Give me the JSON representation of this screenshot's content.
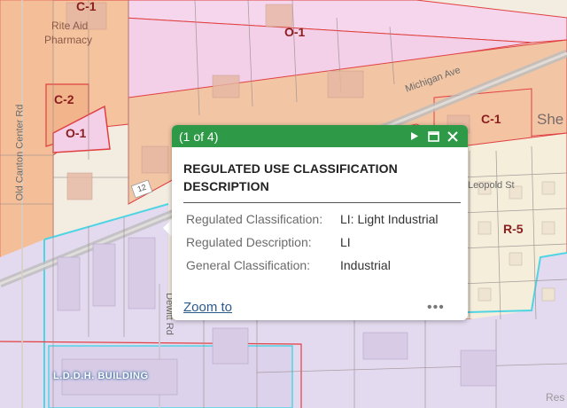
{
  "map": {
    "zones": [
      {
        "label": "C-1",
        "color": "#8a1d1d"
      },
      {
        "label": "O-1",
        "color": "#8a1d1d"
      },
      {
        "label": "C-2",
        "color": "#8a1d1d"
      },
      {
        "label": "O-1",
        "color": "#8a1d1d"
      },
      {
        "label": "C-1",
        "color": "#8a1d1d"
      },
      {
        "label": "R-5",
        "color": "#8a1d1d"
      }
    ],
    "roads": {
      "old_canton": "Old Canton Center Rd",
      "michigan": "Michigan Ave",
      "dewitt": "Dewitt Rd",
      "route": "12",
      "leopold": "Leopold St"
    },
    "places": {
      "pharmacy_line1": "Rite Aid",
      "pharmacy_line2": "Pharmacy",
      "partial_right": "She",
      "partial_corner": "Res"
    },
    "building_label": "L.D.D.H. BUILDING",
    "colors": {
      "commercial": "#f5c8a6",
      "office": "#f4d2ea",
      "residential": "#f4ecd6",
      "industrial": "#e7dcf0",
      "zone_border": "#e04040",
      "industrial_border": "#4fd4e4"
    }
  },
  "popup": {
    "count": "(1 of 4)",
    "title": "REGULATED USE CLASSIFICATION DESCRIPTION",
    "attributes": [
      {
        "key": "Regulated Classification:",
        "value": "LI: Light Industrial"
      },
      {
        "key": "Regulated Description:",
        "value": "LI"
      },
      {
        "key": "General Classification:",
        "value": "Industrial"
      }
    ],
    "zoom_label": "Zoom to",
    "more_label": "•••",
    "header_color": "#2e9a48"
  }
}
